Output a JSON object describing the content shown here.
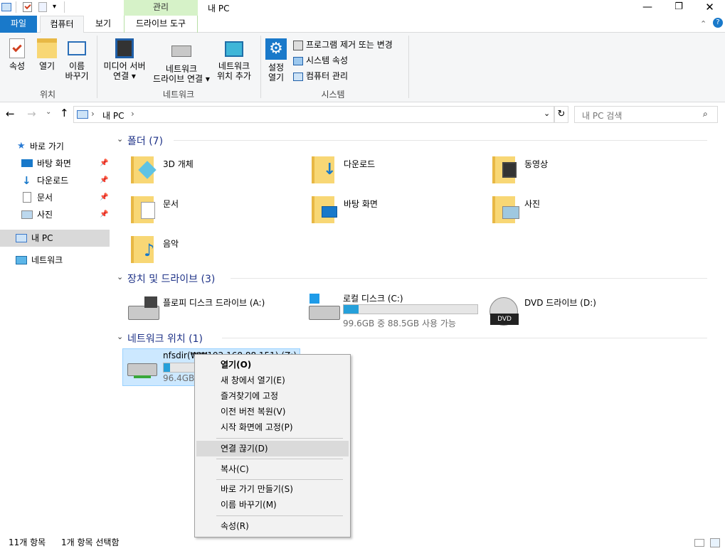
{
  "window": {
    "title": "내 PC",
    "context_tab": "관리"
  },
  "ribbon_tabs": [
    {
      "label": "파일"
    },
    {
      "label": "컴퓨터"
    },
    {
      "label": "보기"
    },
    {
      "label": "드라이브 도구"
    }
  ],
  "ribbon": {
    "groups": {
      "location": "위치",
      "network": "네트워크",
      "system": "시스템"
    },
    "properties": "속성",
    "open": "열기",
    "rename1": "이름",
    "rename2": "바꾸기",
    "media1": "미디어 서버",
    "media2": "연결 ▾",
    "mapdrive1": "네트워크",
    "mapdrive2": "드라이브 연결 ▾",
    "addloc1": "네트워크",
    "addloc2": "위치 추가",
    "settings1": "설정",
    "settings2": "열기",
    "uninstall": "프로그램 제거 또는 변경",
    "sysprops": "시스템 속성",
    "compmgmt": "컴퓨터 관리"
  },
  "address": {
    "path": "내 PC",
    "breadcrumb_sep": "›",
    "search_placeholder": "내 PC 검색"
  },
  "nav": {
    "quick": "바로 가기",
    "desktop": "바탕 화면",
    "downloads": "다운로드",
    "documents": "문서",
    "pictures": "사진",
    "thispc": "내 PC",
    "network": "네트워크"
  },
  "sections": {
    "folders": "폴더 (7)",
    "devices": "장치 및 드라이브 (3)",
    "netloc": "네트워크 위치 (1)"
  },
  "folders": [
    "3D 개체",
    "다운로드",
    "동영상",
    "문서",
    "바탕 화면",
    "사진",
    "음악"
  ],
  "drives": {
    "floppy": "플로피 디스크 드라이브 (A:)",
    "local": "로컬 디스크 (C:)",
    "local_space": "99.6GB 중 88.5GB 사용 가능",
    "local_fill": 0.11,
    "dvd": "DVD 드라이브 (D:)"
  },
  "netdrive": {
    "name": "nfsdir(₩₩192.168.88.151) (Z:)",
    "space": "96.4GB",
    "fill": 0.05
  },
  "context_menu": [
    "열기(O)",
    "새 창에서 열기(E)",
    "즐겨찾기에 고정",
    "이전 버전 복원(V)",
    "시작 화면에 고정(P)",
    "연결 끊기(D)",
    "복사(C)",
    "바로 가기 만들기(S)",
    "이름 바꾸기(M)",
    "속성(R)"
  ],
  "status": {
    "count": "11개 항목",
    "selected": "1개 항목 선택함"
  },
  "colors": {
    "accent": "#1979ca",
    "folder": "#f8d775",
    "bar": "#26a0da",
    "selection": "#cce8ff",
    "context_tab": "#d6f2c8"
  }
}
